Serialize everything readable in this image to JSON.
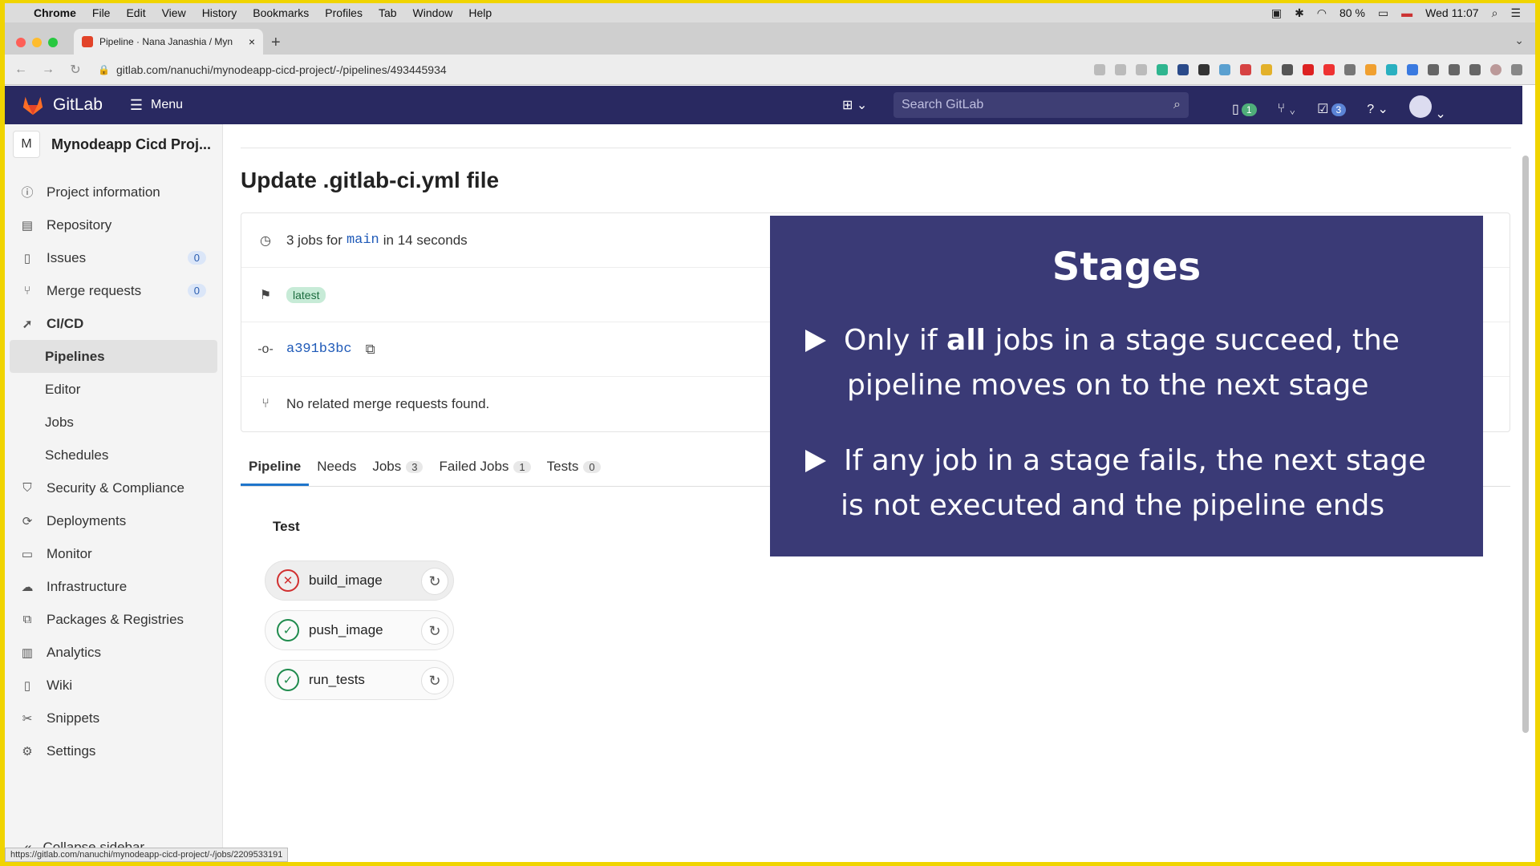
{
  "mac_menu": {
    "items": [
      "Chrome",
      "File",
      "Edit",
      "View",
      "History",
      "Bookmarks",
      "Profiles",
      "Tab",
      "Window",
      "Help"
    ],
    "battery": "80 %",
    "clock": "Wed 11:07"
  },
  "browser": {
    "tab_title": "Pipeline · Nana Janashia / Myn",
    "url": "gitlab.com/nanuchi/mynodeapp-cicd-project/-/pipelines/493445934",
    "status_url": "https://gitlab.com/nanuchi/mynodeapp-cicd-project/-/jobs/2209533191"
  },
  "header": {
    "brand": "GitLab",
    "menu_label": "Menu",
    "search_placeholder": "Search GitLab",
    "issues_count": "1",
    "todos_count": "3"
  },
  "sidebar": {
    "project_initial": "M",
    "project_name": "Mynodeapp Cicd Proj...",
    "items": [
      {
        "label": "Project information",
        "icon": "info-icon"
      },
      {
        "label": "Repository",
        "icon": "book-icon"
      },
      {
        "label": "Issues",
        "icon": "issues-icon",
        "count": "0"
      },
      {
        "label": "Merge requests",
        "icon": "merge-icon",
        "count": "0"
      },
      {
        "label": "CI/CD",
        "icon": "rocket-icon"
      },
      {
        "label": "Pipelines"
      },
      {
        "label": "Editor"
      },
      {
        "label": "Jobs"
      },
      {
        "label": "Schedules"
      },
      {
        "label": "Security & Compliance",
        "icon": "shield-icon"
      },
      {
        "label": "Deployments",
        "icon": "deploy-icon"
      },
      {
        "label": "Monitor",
        "icon": "monitor-icon"
      },
      {
        "label": "Infrastructure",
        "icon": "cloud-icon"
      },
      {
        "label": "Packages & Registries",
        "icon": "package-icon"
      },
      {
        "label": "Analytics",
        "icon": "chart-icon"
      },
      {
        "label": "Wiki",
        "icon": "wiki-icon"
      },
      {
        "label": "Snippets",
        "icon": "scissors-icon"
      },
      {
        "label": "Settings",
        "icon": "gear-icon"
      }
    ],
    "collapse_label": "Collapse sidebar"
  },
  "pipeline": {
    "title": "Update .gitlab-ci.yml file",
    "jobs_prefix": "3 jobs for",
    "branch": "main",
    "duration": "in 14 seconds",
    "tag": "latest",
    "commit": "a391b3bc",
    "merge_requests": "No related merge requests found.",
    "tabs": [
      {
        "label": "Pipeline"
      },
      {
        "label": "Needs"
      },
      {
        "label": "Jobs",
        "count": "3"
      },
      {
        "label": "Failed Jobs",
        "count": "1"
      },
      {
        "label": "Tests",
        "count": "0"
      }
    ],
    "stage_name": "Test",
    "jobs": [
      {
        "name": "build_image",
        "status": "failed"
      },
      {
        "name": "push_image",
        "status": "passed"
      },
      {
        "name": "run_tests",
        "status": "passed"
      }
    ]
  },
  "slide": {
    "title": "Stages",
    "point1_a": "Only if ",
    "point1_bold": "all",
    "point1_b": " jobs in a stage succeed, the",
    "point1_c": "pipeline moves on to the next stage",
    "point2_a": "If any job in a stage fails, the next stage",
    "point2_b": "is not executed and the pipeline ends"
  }
}
